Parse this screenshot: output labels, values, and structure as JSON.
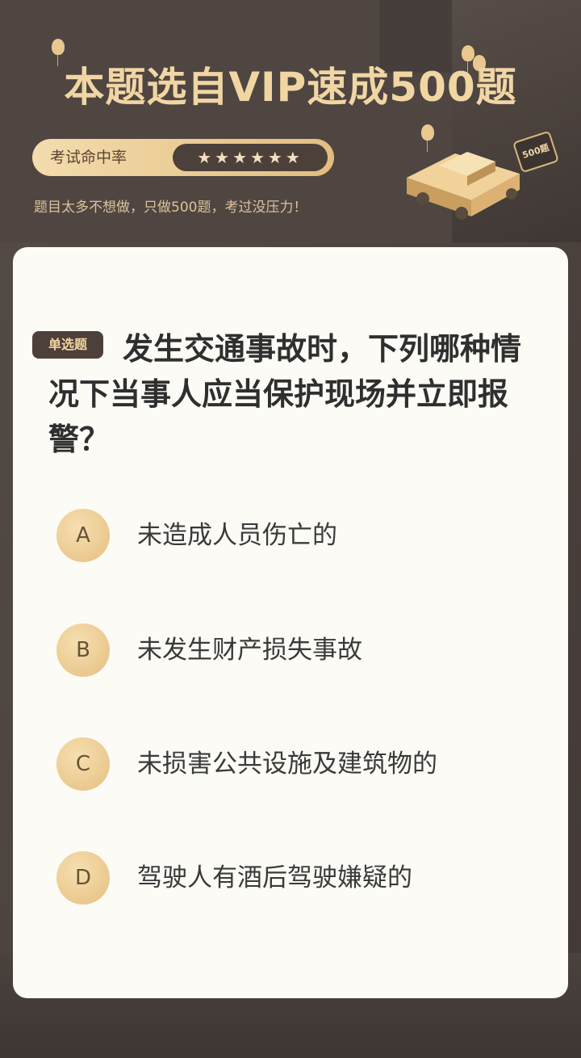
{
  "header": {
    "title": "本题选自VIP速成500题",
    "rate_label": "考试命中率",
    "rate_stars": "★★★★★★",
    "tagline": "题目太多不想做，只做500题，考过没压力！",
    "badge": "500题"
  },
  "question": {
    "type_tag": "单选题",
    "text": "发生交通事故时，下列哪种情况下当事人应当保护现场并立即报警？"
  },
  "options": [
    {
      "letter": "A",
      "text": "未造成人员伤亡的"
    },
    {
      "letter": "B",
      "text": "未发生财产损失事故"
    },
    {
      "letter": "C",
      "text": "未损害公共设施及建筑物的"
    },
    {
      "letter": "D",
      "text": "驾驶人有酒后驾驶嫌疑的"
    }
  ],
  "colors": {
    "background": "#4f4642",
    "gold": "#f1d6a4",
    "card": "#fcfbf5"
  }
}
